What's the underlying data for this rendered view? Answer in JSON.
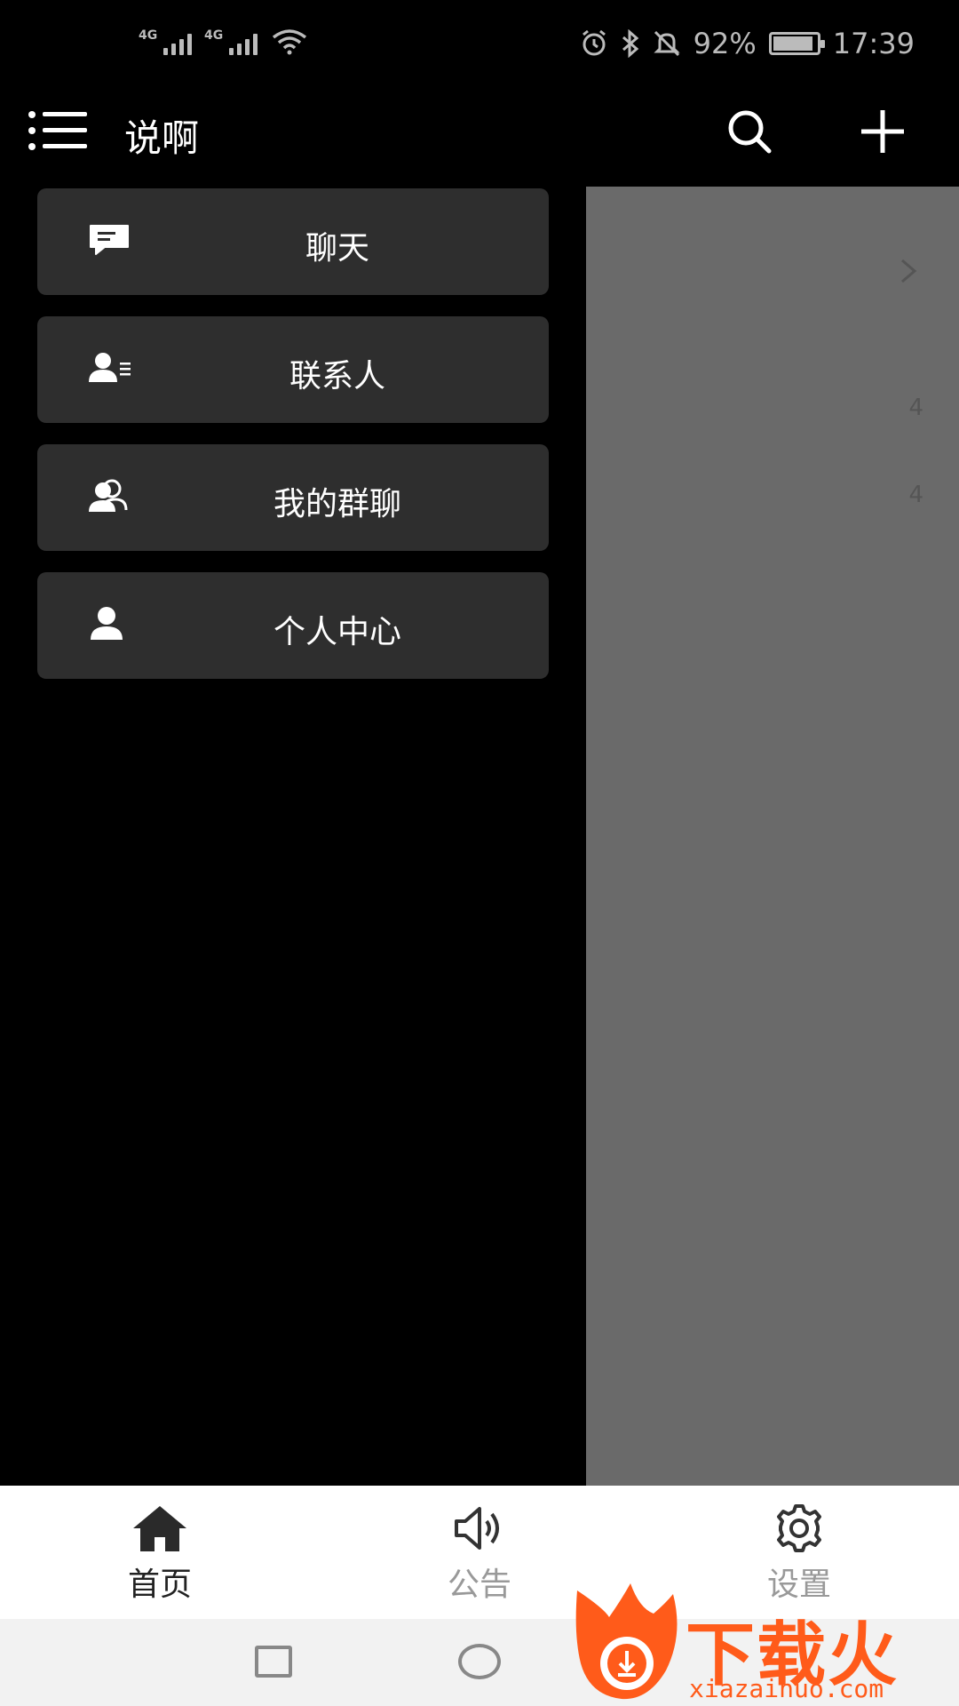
{
  "status_bar": {
    "network1": "4G",
    "network2": "4G",
    "battery_percent": "92%",
    "battery_level": 0.92,
    "time": "17:39",
    "icons": [
      "signal-icon",
      "wifi-icon",
      "alarm-icon",
      "bluetooth-icon",
      "mute-icon",
      "battery-icon"
    ]
  },
  "top_bar": {
    "title": "说啊",
    "icons": [
      "menu-icon",
      "search-icon",
      "add-icon"
    ]
  },
  "drawer": {
    "items": [
      {
        "label": "聊天",
        "icon": "chat-icon"
      },
      {
        "label": "联系人",
        "icon": "contact-card-icon"
      },
      {
        "label": "我的群聊",
        "icon": "group-icon"
      },
      {
        "label": "个人中心",
        "icon": "person-icon"
      }
    ]
  },
  "background_content": {
    "counts": [
      "4",
      "4"
    ]
  },
  "bottom_nav": {
    "items": [
      {
        "label": "首页",
        "icon": "home-icon",
        "active": true
      },
      {
        "label": "公告",
        "icon": "megaphone-icon",
        "active": false
      },
      {
        "label": "设置",
        "icon": "gear-icon",
        "active": false
      }
    ]
  },
  "watermark": {
    "title": "下载火",
    "url": "xiazaihuo.com"
  },
  "colors": {
    "drawer_item_bg": "#2e2e2e",
    "scrim": "#6a6a6a",
    "watermark": "#ff5b1a",
    "nav_active": "#222222",
    "nav_inactive": "#999999"
  }
}
